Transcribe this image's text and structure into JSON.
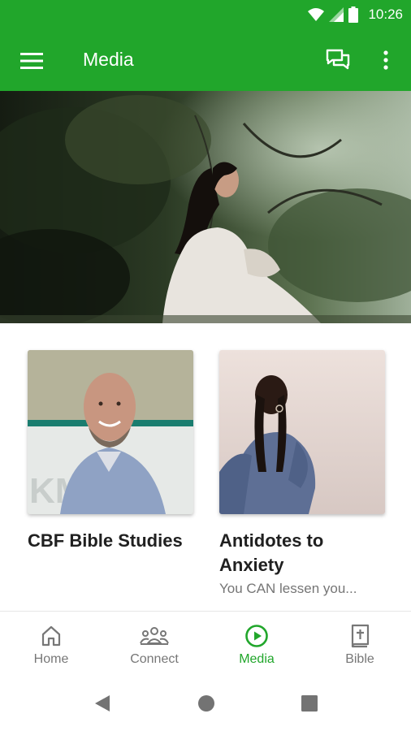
{
  "status_bar": {
    "time": "10:26",
    "icons": [
      "wifi-icon",
      "signal-icon",
      "battery-icon"
    ]
  },
  "app_bar": {
    "title": "Media",
    "menu_icon": "hamburger-menu-icon",
    "chat_icon": "chat-bubbles-icon",
    "more_icon": "more-vertical-icon",
    "background": "#21a62b"
  },
  "hero": {
    "image": "woman sitting in forest photo"
  },
  "cards": [
    {
      "title": "CBF Bible Studies",
      "subtitle": ""
    },
    {
      "title": "Antidotes to Anxiety",
      "subtitle": "You CAN lessen you..."
    }
  ],
  "bottom_nav": {
    "items": [
      {
        "label": "Home",
        "icon": "home-icon",
        "active": false
      },
      {
        "label": "Connect",
        "icon": "people-group-icon",
        "active": false
      },
      {
        "label": "Media",
        "icon": "play-circle-icon",
        "active": true
      },
      {
        "label": "Bible",
        "icon": "bible-book-icon",
        "active": false
      }
    ],
    "active_color": "#21a62b"
  },
  "system_nav": [
    "back-icon",
    "home-circle-icon",
    "recents-icon"
  ]
}
